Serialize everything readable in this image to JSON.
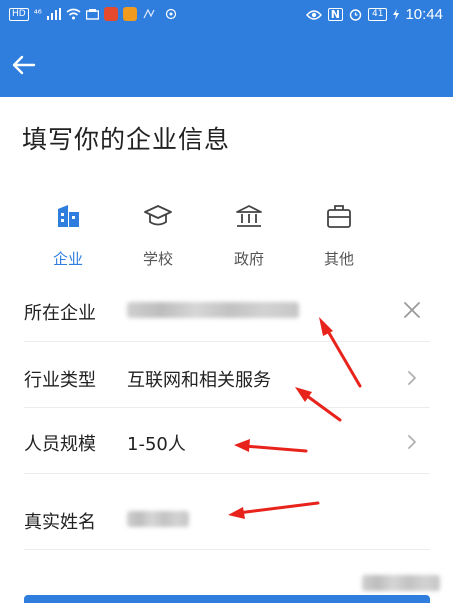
{
  "status_bar": {
    "signal_tags": [
      "HD",
      "⁴⁶"
    ],
    "nfc_label": "N",
    "battery": "41",
    "time": "10:44"
  },
  "header": {
    "back_icon": "arrow-left-icon"
  },
  "page": {
    "title": "填写你的企业信息"
  },
  "tabs": [
    {
      "label": "企业",
      "icon": "building-icon",
      "active": true
    },
    {
      "label": "学校",
      "icon": "graduation-cap-icon",
      "active": false
    },
    {
      "label": "政府",
      "icon": "government-icon",
      "active": false
    },
    {
      "label": "其他",
      "icon": "briefcase-icon",
      "active": false
    }
  ],
  "form": {
    "company": {
      "label": "所在企业",
      "value": "",
      "action_icon": "close-icon"
    },
    "industry": {
      "label": "行业类型",
      "value": "互联网和相关服务",
      "action_icon": "chevron-right-icon"
    },
    "scale": {
      "label": "人员规模",
      "value": "1-50人",
      "action_icon": "chevron-right-icon"
    },
    "name": {
      "label": "真实姓名",
      "value": ""
    }
  },
  "colors": {
    "brand": "#2f7ede",
    "annotation_red": "#e8231b",
    "divider": "#ececec"
  }
}
